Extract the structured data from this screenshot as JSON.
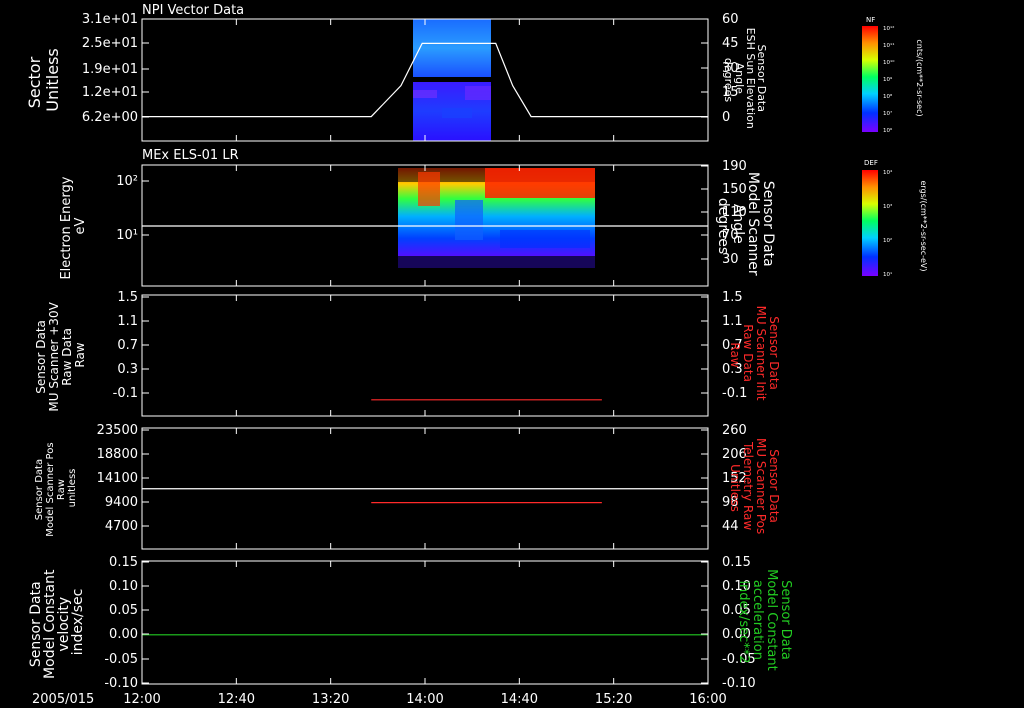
{
  "colors": {
    "background": "#000000",
    "axis": "#ffffff",
    "red_trace": "#ff2a2a",
    "green_trace": "#22cc22",
    "white_trace": "#ffffff"
  },
  "time_axis": {
    "date_label": "2005/015",
    "ticks": [
      "12:00",
      "12:40",
      "13:20",
      "14:00",
      "14:40",
      "15:20",
      "16:00"
    ]
  },
  "chart_data": [
    {
      "type": "heatmap",
      "title": "NPI Vector Data",
      "ylabel_left": [
        "Sector",
        "Unitless"
      ],
      "left_ticks": [
        "3.1e+01",
        "2.5e+01",
        "1.9e+01",
        "1.2e+01",
        "6.2e+00"
      ],
      "ylabel_right": [
        "Sensor Data",
        "ESH Sun Elevation",
        "Angle",
        "degrees"
      ],
      "right_ticks": [
        "60",
        "45",
        "30",
        "15",
        "0"
      ],
      "right_ylim": [
        -15,
        60
      ],
      "overlay_line": {
        "color": "#ffffff",
        "x_hours": [
          12.0,
          13.62,
          13.83,
          13.98,
          14.5,
          14.62,
          14.75,
          16.0
        ],
        "y_degrees": [
          0,
          0,
          19,
          45,
          45,
          19,
          0,
          0
        ]
      },
      "colorbar": {
        "label": "NF",
        "unit": "cnts/(cm**2-sr-sec)",
        "ticks": [
          "10¹²",
          "10¹¹",
          "10¹⁰",
          "10⁹",
          "10⁸",
          "10⁷",
          "10⁶"
        ]
      }
    },
    {
      "type": "heatmap",
      "title": "MEx ELS-01 LR",
      "ylabel_left": [
        "Electron Energy",
        "eV"
      ],
      "left_ticks": [
        "10²",
        "10¹"
      ],
      "ylabel_right": [
        "Sensor Data",
        "Model Scanner",
        "Angle",
        "degrees"
      ],
      "right_ticks": [
        "190",
        "150",
        "110",
        "70",
        "30"
      ],
      "overlay_line": {
        "color": "#ffffff",
        "y_degrees": 92
      },
      "colorbar": {
        "label": "DEF",
        "unit": "ergs/(cm**2-sr-sec-eV)",
        "ticks": [
          "10⁴",
          "10³",
          "10²",
          "10¹"
        ]
      }
    },
    {
      "type": "line",
      "ylabel_left": [
        "Sensor Data",
        "MU Scanner +30V",
        "Raw Data",
        "Raw"
      ],
      "left_ticks": [
        "1.5",
        "1.1",
        "0.7",
        "0.3",
        "-0.1"
      ],
      "ylabel_right": [
        "Sensor Data",
        "MU Scanner Init",
        "Raw Data",
        "Raw"
      ],
      "right_ticks": [
        "1.5",
        "1.1",
        "0.7",
        "0.3",
        "-0.1"
      ],
      "ylim": [
        -0.3,
        1.5
      ],
      "series": [
        {
          "color": "#ff2a2a",
          "x_hours": [
            13.62,
            15.25
          ],
          "values": [
            0,
            0
          ]
        }
      ]
    },
    {
      "type": "line",
      "ylabel_left": [
        "Sensor Data",
        "Model Scanner Pos",
        "Raw",
        "unitless"
      ],
      "left_ticks": [
        "23500",
        "18800",
        "14100",
        "9400",
        "4700"
      ],
      "ylabel_right": [
        "Sensor Data",
        "MU Scanner Pos",
        "Telemetry Raw",
        "Unitless"
      ],
      "right_ticks": [
        "260",
        "206",
        "152",
        "98",
        "44"
      ],
      "ylim": [
        0,
        23500
      ],
      "series": [
        {
          "color": "#ffffff",
          "x_hours": [
            12.0,
            16.0
          ],
          "values": [
            11700,
            11700
          ]
        },
        {
          "color": "#ff2a2a",
          "x_hours": [
            13.62,
            15.25
          ],
          "values": [
            9000,
            9000
          ]
        }
      ]
    },
    {
      "type": "line",
      "ylabel_left": [
        "Sensor Data",
        "Model Constant",
        "velocity",
        "index/sec"
      ],
      "left_ticks": [
        "0.15",
        "0.10",
        "0.05",
        "0.00",
        "-0.05",
        "-0.10"
      ],
      "ylabel_right": [
        "Sensor Data",
        "Model Constant",
        "acceleration",
        "index/sec**2"
      ],
      "right_ticks": [
        "0.15",
        "0.10",
        "0.05",
        "0.00",
        "-0.05",
        "-0.10"
      ],
      "ylim": [
        -0.1,
        0.15
      ],
      "series": [
        {
          "color": "#22cc22",
          "x_hours": [
            12.0,
            16.0
          ],
          "values": [
            0,
            0
          ]
        }
      ]
    }
  ]
}
